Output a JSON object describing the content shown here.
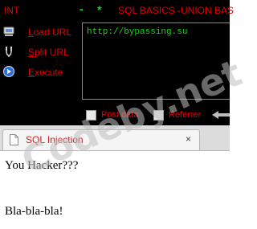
{
  "hackbar": {
    "menu": {
      "int": "INT",
      "minus": "-",
      "star": "*",
      "sql_basics": "SQL BASICS",
      "union_based": "UNION BAS"
    },
    "actions": [
      {
        "label": "Load URL",
        "icon": "load-url-icon"
      },
      {
        "label": "Split URL",
        "icon": "split-url-icon"
      },
      {
        "label": "Execute",
        "icon": "execute-icon"
      }
    ],
    "url_value": "http://bypassing.su",
    "options": {
      "post_data": "Post data",
      "referrer": "Referrer"
    },
    "colors": {
      "label": "#e00000",
      "url_text": "#19d619",
      "background": "#000000"
    }
  },
  "tab": {
    "title": "SQL Injection",
    "close": "×"
  },
  "page": {
    "line1": "You Hacker???",
    "line2": "Bla-bla-bla!"
  },
  "watermark": "Codeby.net"
}
